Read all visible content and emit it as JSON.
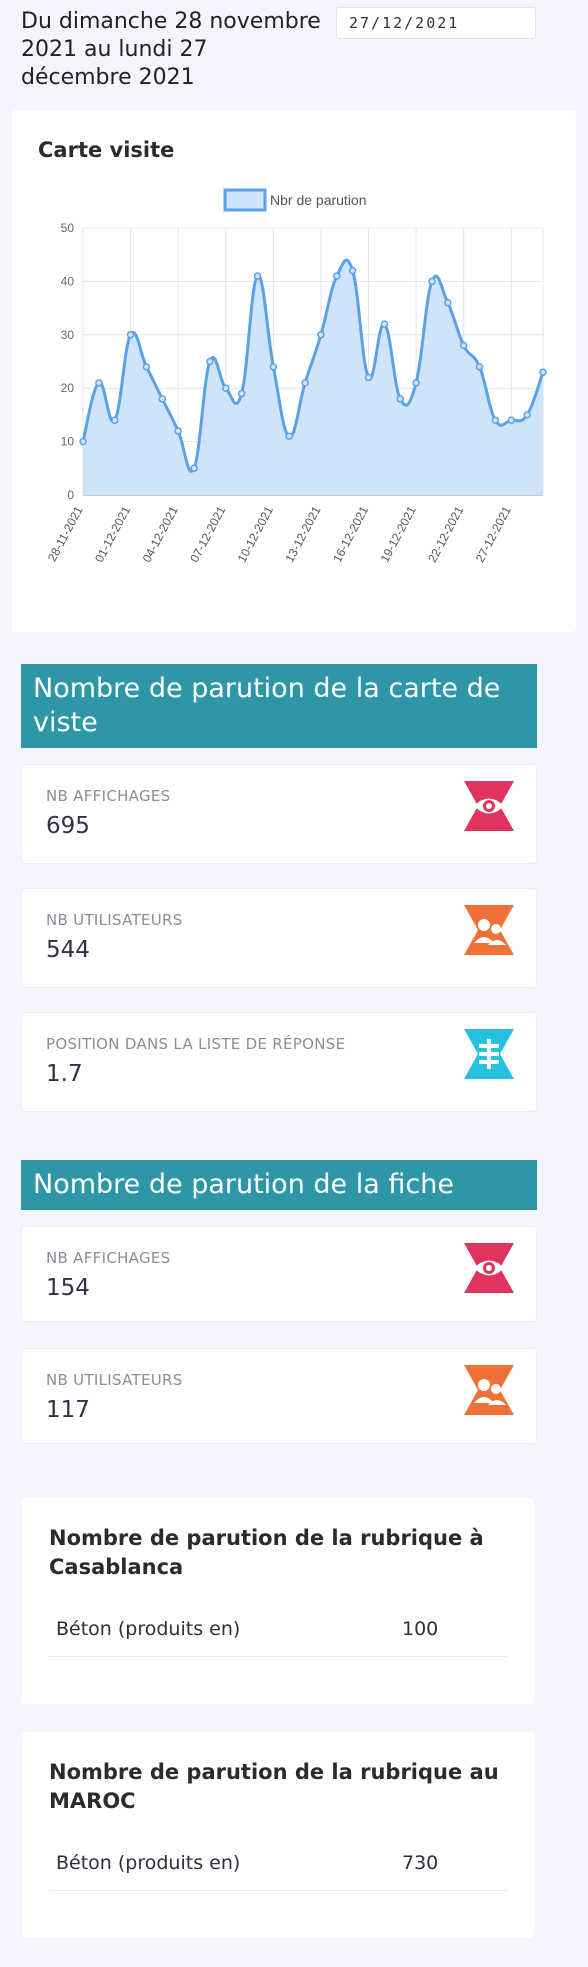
{
  "header": {
    "period_text": "Du dimanche 28 novembre 2021 au lundi 27 décembre 2021",
    "date_value": "27/12/2021"
  },
  "chart_card": {
    "title": "Carte visite"
  },
  "chart_data": {
    "type": "area",
    "title": "Carte visite",
    "x_tick_labels": [
      "28-11-2021",
      "01-12-2021",
      "04-12-2021",
      "07-12-2021",
      "10-12-2021",
      "13-12-2021",
      "16-12-2021",
      "19-12-2021",
      "22-12-2021",
      "27-12-2021"
    ],
    "x": [
      "28-11-2021",
      "29-11-2021",
      "30-11-2021",
      "01-12-2021",
      "02-12-2021",
      "03-12-2021",
      "04-12-2021",
      "05-12-2021",
      "06-12-2021",
      "07-12-2021",
      "08-12-2021",
      "09-12-2021",
      "10-12-2021",
      "11-12-2021",
      "12-12-2021",
      "13-12-2021",
      "14-12-2021",
      "15-12-2021",
      "16-12-2021",
      "17-12-2021",
      "18-12-2021",
      "19-12-2021",
      "20-12-2021",
      "21-12-2021",
      "22-12-2021",
      "23-12-2021",
      "24-12-2021",
      "25-12-2021",
      "26-12-2021",
      "27-12-2021"
    ],
    "series": [
      {
        "name": "Nbr de parution",
        "values": [
          10,
          21,
          14,
          30,
          24,
          18,
          12,
          5,
          25,
          20,
          19,
          41,
          24,
          11,
          21,
          30,
          41,
          42,
          22,
          32,
          18,
          21,
          40,
          36,
          28,
          24,
          14,
          14,
          15,
          23
        ]
      }
    ],
    "yticks": [
      0,
      10,
      20,
      30,
      40,
      50
    ],
    "ylim": [
      0,
      50
    ],
    "legend_position": "top",
    "grid": true,
    "colors": {
      "line": "#5aa2e8",
      "fill": "#cfe4fb"
    }
  },
  "section1": {
    "title": "Nombre de parution de la carte de viste",
    "cards": [
      {
        "label": "NB AFFICHAGES",
        "value": "695",
        "icon": "eye-icon",
        "color": "#e0335e"
      },
      {
        "label": "NB UTILISATEURS",
        "value": "544",
        "icon": "users-icon",
        "color": "#f07138"
      },
      {
        "label": "POSITION DANS LA LISTE DE RÉPONSE",
        "value": "1.7",
        "icon": "list-icon",
        "color": "#23c0e0"
      }
    ]
  },
  "section2": {
    "title": "Nombre de parution de la fiche",
    "cards": [
      {
        "label": "NB AFFICHAGES",
        "value": "154",
        "icon": "eye-icon",
        "color": "#e0335e"
      },
      {
        "label": "NB UTILISATEURS",
        "value": "117",
        "icon": "users-icon",
        "color": "#f07138"
      }
    ]
  },
  "rubrique_casablanca": {
    "title": "Nombre de parution de la rubrique à Casablanca",
    "rows": [
      {
        "label": "Béton (produits en)",
        "value": "100"
      }
    ]
  },
  "rubrique_maroc": {
    "title": "Nombre de parution de la rubrique au MAROC",
    "rows": [
      {
        "label": "Béton (produits en)",
        "value": "730"
      }
    ]
  }
}
